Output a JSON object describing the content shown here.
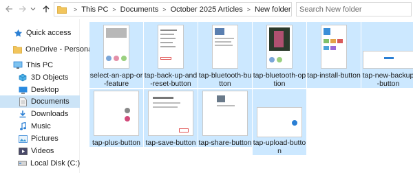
{
  "nav_buttons": [
    "back-arrow-icon",
    "forward-arrow-icon",
    "recent-chevron-icon",
    "up-arrow-icon"
  ],
  "address": {
    "crumbs": [
      "This PC",
      "Documents",
      "October 2025 Articles",
      "New folder"
    ]
  },
  "search": {
    "placeholder": "Search New folder"
  },
  "sidebar": {
    "items": [
      {
        "label": "Quick access",
        "icon": "star-icon"
      },
      {
        "label": "OneDrive - Personal",
        "icon": "folder-icon"
      },
      {
        "label": "This PC",
        "icon": "computer-icon"
      },
      {
        "label": "3D Objects",
        "icon": "cube-icon"
      },
      {
        "label": "Desktop",
        "icon": "desktop-icon"
      },
      {
        "label": "Documents",
        "icon": "document-icon",
        "selected": true
      },
      {
        "label": "Downloads",
        "icon": "download-icon"
      },
      {
        "label": "Music",
        "icon": "music-icon"
      },
      {
        "label": "Pictures",
        "icon": "pictures-icon"
      },
      {
        "label": "Videos",
        "icon": "video-icon"
      },
      {
        "label": "Local Disk (C:)",
        "icon": "disk-icon"
      }
    ]
  },
  "files": [
    {
      "name": "select-an-app-or-feature"
    },
    {
      "name": "tap-back-up-and-reset-button"
    },
    {
      "name": "tap-bluetooth-button"
    },
    {
      "name": "tap-bluetooth-option"
    },
    {
      "name": "tap-install-button"
    },
    {
      "name": "tap-new-backup-button"
    },
    {
      "name": "tap-plus-button"
    },
    {
      "name": "tap-save-button"
    },
    {
      "name": "tap-share-button"
    },
    {
      "name": "tap-upload-button"
    }
  ],
  "colors": {
    "selection": "#cce8ff",
    "nav_selected": "#cce4f7",
    "accent": "#0078d7"
  }
}
